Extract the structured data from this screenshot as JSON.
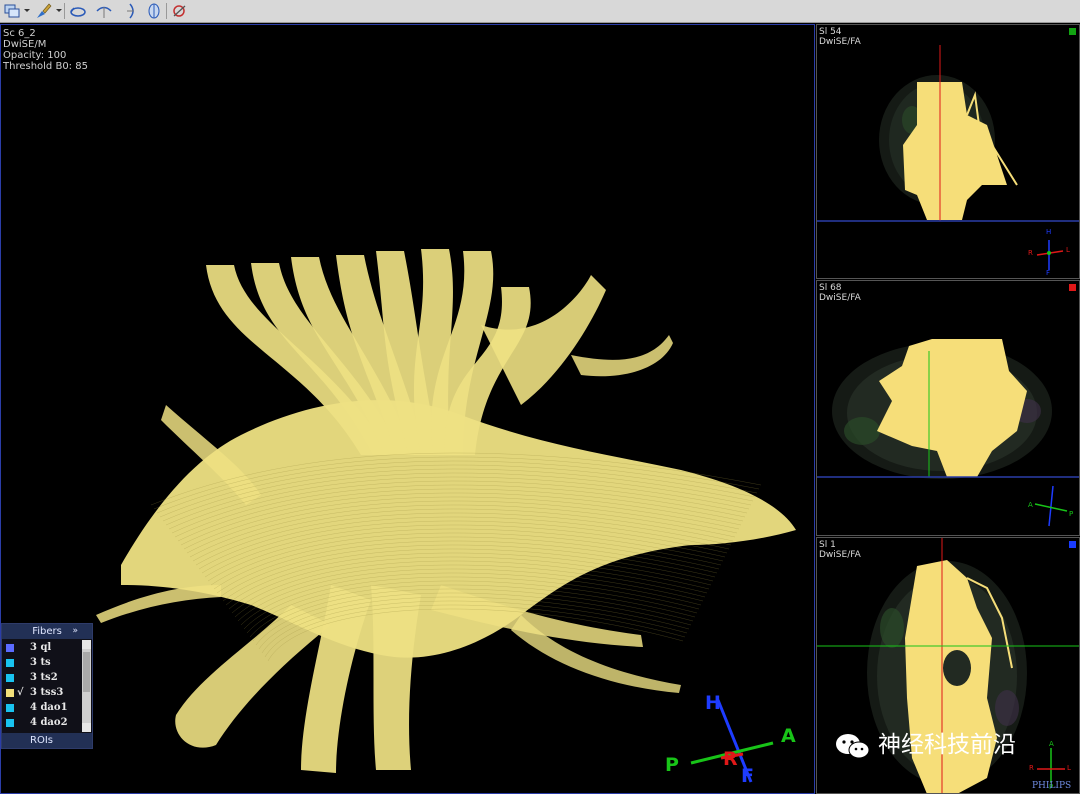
{
  "toolbar": {
    "buttons": [
      {
        "icon": "view-layout-icon",
        "has_dropdown": true
      },
      {
        "icon": "paint-tool-icon",
        "has_dropdown": true
      },
      {
        "icon": "rotate-view-icon",
        "has_dropdown": false
      },
      {
        "icon": "flip-horizontal-icon",
        "has_dropdown": false
      },
      {
        "icon": "flip-vertical-icon",
        "has_dropdown": false
      },
      {
        "icon": "sagittal-view-icon",
        "has_dropdown": false
      },
      {
        "icon": "reset-view-icon",
        "has_dropdown": false
      }
    ]
  },
  "main_view": {
    "info_lines": [
      "Sc 6_2",
      "DwiSE/M",
      "Opacity: 100",
      "Threshold B0: 85"
    ],
    "fiber_color": "#eee183",
    "orientation": {
      "labels": [
        "H",
        "A",
        "P",
        "R",
        "F"
      ],
      "colors": {
        "H": "#1e3cff",
        "F": "#1e3cff",
        "A": "#18c418",
        "P": "#18c418",
        "R": "#e01818"
      }
    }
  },
  "fibers_panel": {
    "title": "Fibers",
    "more_glyph": "»",
    "items": [
      {
        "label": "3 ql",
        "color": "#5b6bff",
        "checked": false
      },
      {
        "label": "3 ts",
        "color": "#19c3f0",
        "checked": false
      },
      {
        "label": "3 ts2",
        "color": "#19c3f0",
        "checked": false
      },
      {
        "label": "3 tss3",
        "color": "#f2e07a",
        "checked": true
      },
      {
        "label": "4 dao1",
        "color": "#19c3f0",
        "checked": false
      },
      {
        "label": "4 dao2",
        "color": "#19c3f0",
        "checked": false
      }
    ],
    "check_glyph": "√",
    "rois_label": "ROIs"
  },
  "side_views": [
    {
      "title": "Sl 54",
      "subtitle": "DwiSE/FA",
      "indicator_color": "#12a412",
      "orient_labels": [
        "H",
        "R",
        "L",
        "F"
      ]
    },
    {
      "title": "Sl 68",
      "subtitle": "DwiSE/FA",
      "indicator_color": "#e01818",
      "orient_labels": [
        "A",
        "P"
      ]
    },
    {
      "title": "Sl 1",
      "subtitle": "DwiSE/FA",
      "indicator_color": "#1a3cff",
      "orient_labels": [
        "A",
        "R",
        "L",
        "P"
      ]
    }
  ],
  "watermark": {
    "text": "神经科技前沿",
    "icon": "wechat-icon"
  },
  "brand": "PHILIPS"
}
